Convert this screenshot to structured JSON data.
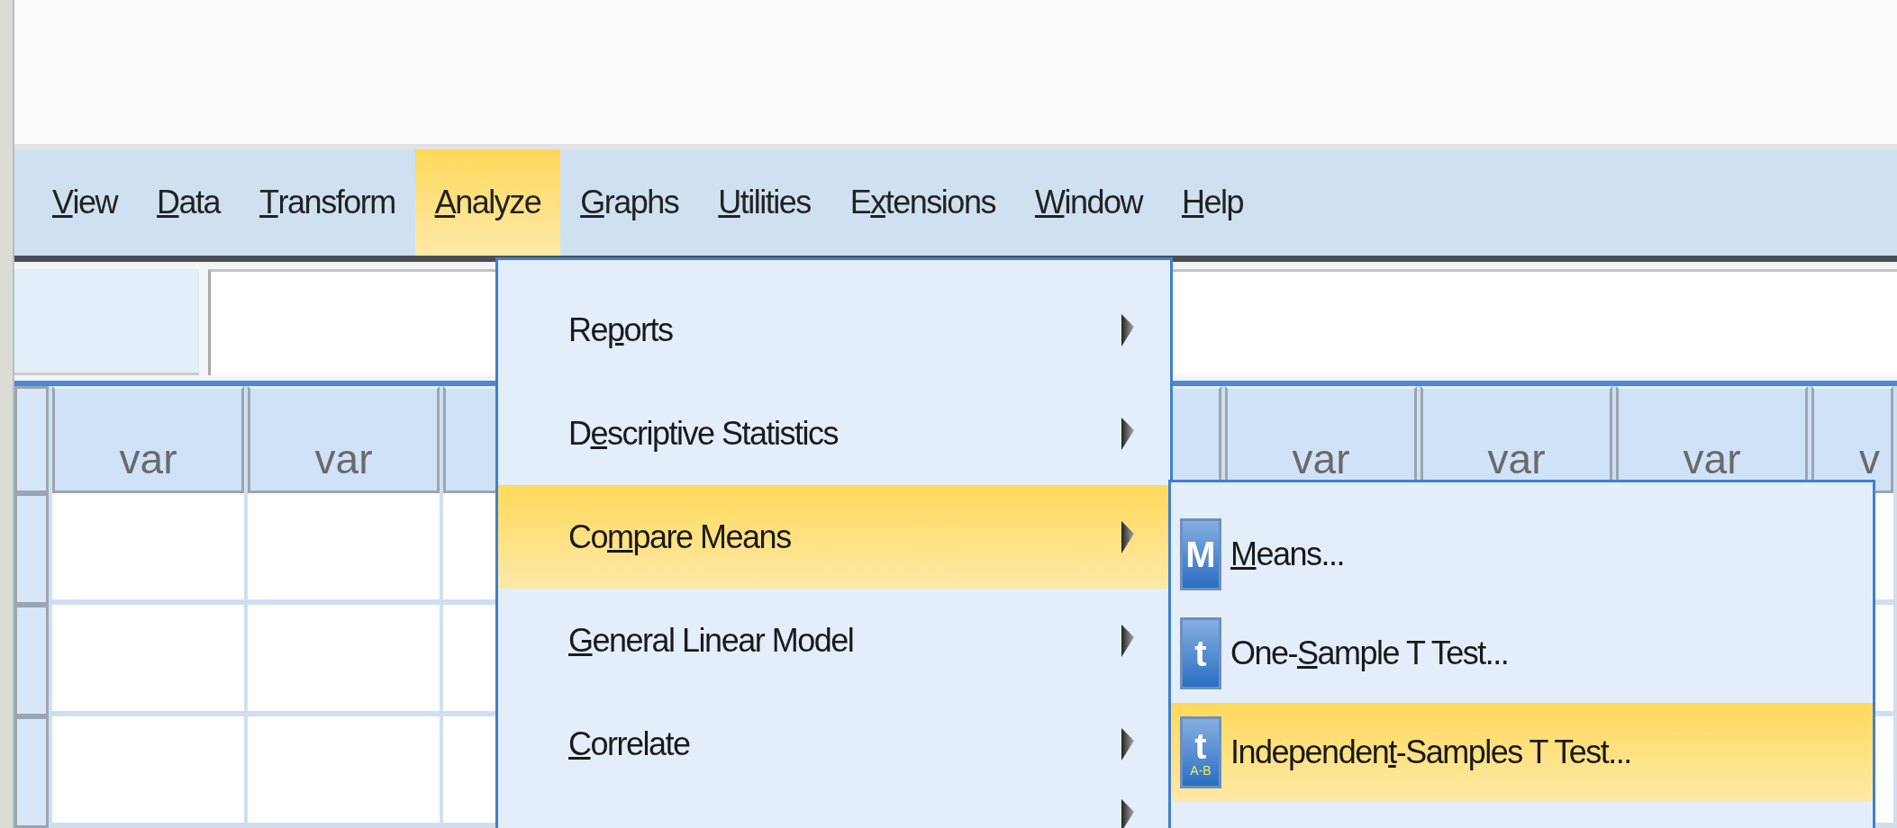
{
  "menubar": [
    {
      "key": "V",
      "after": "iew",
      "selected": false
    },
    {
      "key": "D",
      "after": "ata",
      "selected": false
    },
    {
      "key": "T",
      "after": "ransform",
      "selected": false
    },
    {
      "key": "A",
      "after": "nalyze",
      "selected": true
    },
    {
      "key": "G",
      "after": "raphs",
      "selected": false
    },
    {
      "key": "U",
      "after": "tilities",
      "selected": false
    },
    {
      "before": "E",
      "key": "x",
      "after": "tensions",
      "selected": false
    },
    {
      "key": "W",
      "after": "indow",
      "selected": false
    },
    {
      "key": "H",
      "after": "elp",
      "selected": false
    }
  ],
  "grid": {
    "left_columns": [
      "var",
      "var"
    ],
    "right_columns": [
      "var",
      "var",
      "var",
      "v"
    ]
  },
  "analyze_menu": [
    {
      "before": "Re",
      "key": "p",
      "after": "orts",
      "selected": false
    },
    {
      "before": "D",
      "key": "e",
      "after": "scriptive Statistics",
      "selected": false
    },
    {
      "before": "Co",
      "key": "m",
      "after": "pare Means",
      "selected": true
    },
    {
      "key": "G",
      "after": "eneral Linear Model",
      "selected": false
    },
    {
      "key": "C",
      "after": "orrelate",
      "selected": false
    }
  ],
  "compare_means_menu": [
    {
      "key": "M",
      "after": "eans...",
      "selected": false,
      "icon": {
        "glyph": "M"
      }
    },
    {
      "before": "One-",
      "key": "S",
      "after": "ample T Test...",
      "selected": false,
      "icon": {
        "glyph": "t"
      }
    },
    {
      "before": "Independen",
      "key": "t",
      "after": "-Samples T Test...",
      "selected": true,
      "icon": {
        "glyph": "t",
        "sub": "A-B"
      }
    }
  ]
}
